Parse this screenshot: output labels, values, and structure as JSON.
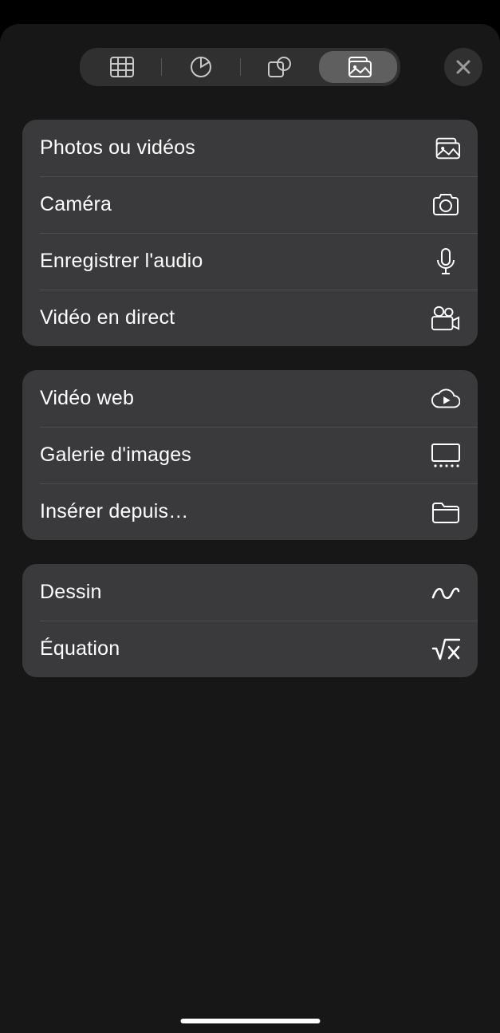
{
  "tabs": {
    "table": "table",
    "chart": "chart",
    "shape": "shape",
    "media": "media",
    "active": "media"
  },
  "groups": [
    {
      "items": [
        {
          "label": "Photos ou vidéos",
          "icon": "photos-icon"
        },
        {
          "label": "Caméra",
          "icon": "camera-icon"
        },
        {
          "label": "Enregistrer l'audio",
          "icon": "microphone-icon"
        },
        {
          "label": "Vidéo en direct",
          "icon": "video-camera-icon"
        }
      ]
    },
    {
      "items": [
        {
          "label": "Vidéo web",
          "icon": "cloud-play-icon"
        },
        {
          "label": "Galerie d'images",
          "icon": "gallery-icon"
        },
        {
          "label": "Insérer depuis…",
          "icon": "folder-icon"
        }
      ]
    },
    {
      "items": [
        {
          "label": "Dessin",
          "icon": "scribble-icon"
        },
        {
          "label": "Équation",
          "icon": "equation-icon"
        }
      ]
    }
  ]
}
